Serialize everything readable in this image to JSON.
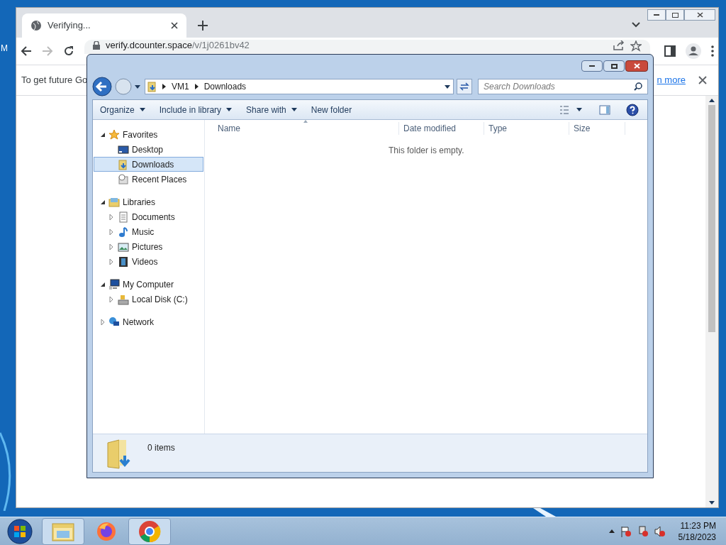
{
  "desktop": {
    "label_fragment": "M"
  },
  "browser": {
    "tab": {
      "title": "Verifying...",
      "selected": true
    },
    "url": {
      "host": "verify.dcounter.space",
      "path": "/v/1j0261bv42"
    },
    "infobar": {
      "text": "To get future Go",
      "link": "n more"
    }
  },
  "explorer": {
    "breadcrumb": [
      "VM1",
      "Downloads"
    ],
    "search": {
      "placeholder": "Search Downloads"
    },
    "commands": [
      {
        "label": "Organize",
        "dropdown": true
      },
      {
        "label": "Include in library",
        "dropdown": true
      },
      {
        "label": "Share with",
        "dropdown": true
      },
      {
        "label": "New folder",
        "dropdown": false
      }
    ],
    "nav": [
      {
        "label": "Favorites",
        "kind": "star",
        "expanded": true,
        "children": [
          {
            "label": "Desktop",
            "kind": "desktop",
            "has_children": false,
            "selected": false
          },
          {
            "label": "Downloads",
            "kind": "downloads",
            "has_children": false,
            "selected": true
          },
          {
            "label": "Recent Places",
            "kind": "recent",
            "has_children": false,
            "selected": false
          }
        ]
      },
      {
        "label": "Libraries",
        "kind": "library",
        "expanded": true,
        "children": [
          {
            "label": "Documents",
            "kind": "documents",
            "has_children": true,
            "selected": false
          },
          {
            "label": "Music",
            "kind": "music",
            "has_children": true,
            "selected": false
          },
          {
            "label": "Pictures",
            "kind": "pictures",
            "has_children": true,
            "selected": false
          },
          {
            "label": "Videos",
            "kind": "videos",
            "has_children": true,
            "selected": false
          }
        ]
      },
      {
        "label": "My Computer",
        "kind": "computer",
        "expanded": true,
        "children": [
          {
            "label": "Local Disk (C:)",
            "kind": "disk",
            "has_children": true,
            "selected": false
          }
        ]
      },
      {
        "label": "Network",
        "kind": "network",
        "expanded": false
      }
    ],
    "columns": [
      "Name",
      "Date modified",
      "Type",
      "Size"
    ],
    "empty_message": "This folder is empty.",
    "status": "0 items"
  },
  "taskbar": {
    "apps": [
      {
        "kind": "explorer",
        "selected": true
      },
      {
        "kind": "firefox",
        "selected": false
      },
      {
        "kind": "chrome",
        "selected": true
      }
    ],
    "time": "11:23 PM",
    "date": "5/18/2023"
  }
}
